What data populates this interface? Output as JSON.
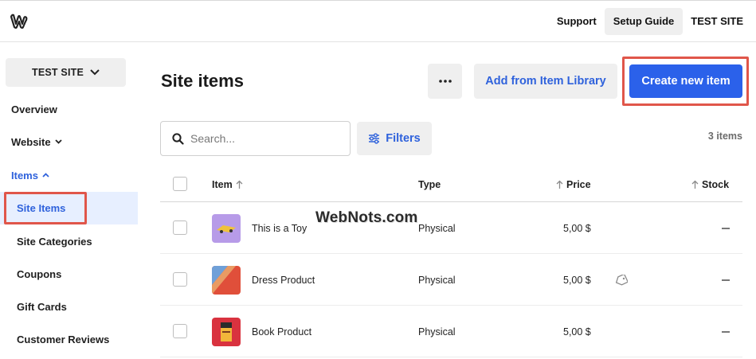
{
  "topbar": {
    "logo_icon": "weebly-w-icon",
    "support": "Support",
    "setup_guide": "Setup Guide",
    "site_name": "TEST SITE"
  },
  "sidebar": {
    "site_selector": "TEST SITE",
    "items": [
      {
        "label": "Overview"
      },
      {
        "label": "Website"
      },
      {
        "label": "Items"
      },
      {
        "label": "Site Items"
      },
      {
        "label": "Site Categories"
      },
      {
        "label": "Coupons"
      },
      {
        "label": "Gift Cards"
      },
      {
        "label": "Customer Reviews"
      }
    ]
  },
  "main": {
    "title": "Site items",
    "more_icon": "ellipsis-icon",
    "add_from_library": "Add from Item Library",
    "create_new_item": "Create new item",
    "search_placeholder": "Search...",
    "filters": "Filters",
    "item_count": "3 items"
  },
  "table": {
    "columns": [
      "Item",
      "Type",
      "Price",
      "Stock"
    ],
    "rows": [
      {
        "name": "This is a Toy",
        "type": "Physical",
        "price": "5,00 $",
        "stock": "–",
        "thumb_color": "#b79be8",
        "on_sale": false
      },
      {
        "name": "Dress Product",
        "type": "Physical",
        "price": "5,00 $",
        "stock": "–",
        "thumb_color": "#e04f3a",
        "on_sale": true
      },
      {
        "name": "Book Product",
        "type": "Physical",
        "price": "5,00 $",
        "stock": "–",
        "thumb_color": "#d9323f",
        "on_sale": false
      }
    ]
  },
  "watermark": "WebNots.com",
  "colors": {
    "accent": "#2b61ea",
    "highlight": "#e0564a",
    "selected_bg": "#e7efff"
  }
}
